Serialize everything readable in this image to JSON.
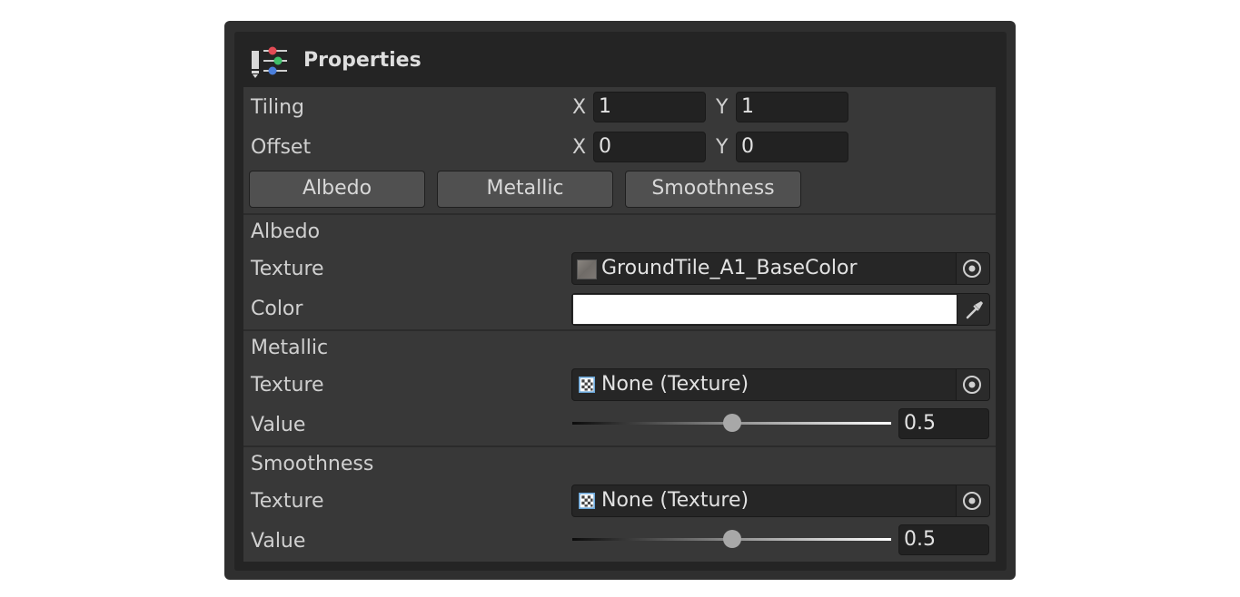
{
  "panel": {
    "title": "Properties",
    "icon": "material-properties-icon"
  },
  "tiling": {
    "label": "Tiling",
    "x_label": "X",
    "x_value": "1",
    "y_label": "Y",
    "y_value": "1"
  },
  "offset": {
    "label": "Offset",
    "x_label": "X",
    "x_value": "0",
    "y_label": "Y",
    "y_value": "0"
  },
  "tabs": [
    {
      "label": "Albedo"
    },
    {
      "label": "Metallic"
    },
    {
      "label": "Smoothness"
    }
  ],
  "albedo": {
    "section_label": "Albedo",
    "texture_label": "Texture",
    "texture_value": "GroundTile_A1_BaseColor",
    "color_label": "Color",
    "color_value": "#ffffff"
  },
  "metallic": {
    "section_label": "Metallic",
    "texture_label": "Texture",
    "texture_value": "None (Texture)",
    "value_label": "Value",
    "value": "0.5",
    "slider_fraction": 0.5
  },
  "smoothness": {
    "section_label": "Smoothness",
    "texture_label": "Texture",
    "texture_value": "None (Texture)",
    "value_label": "Value",
    "value": "0.5",
    "slider_fraction": 0.5
  },
  "colors": {
    "window_bg": "#2f2f2f",
    "panel_bg": "#383838",
    "field_bg": "#222222",
    "tab_bg": "#505050"
  }
}
